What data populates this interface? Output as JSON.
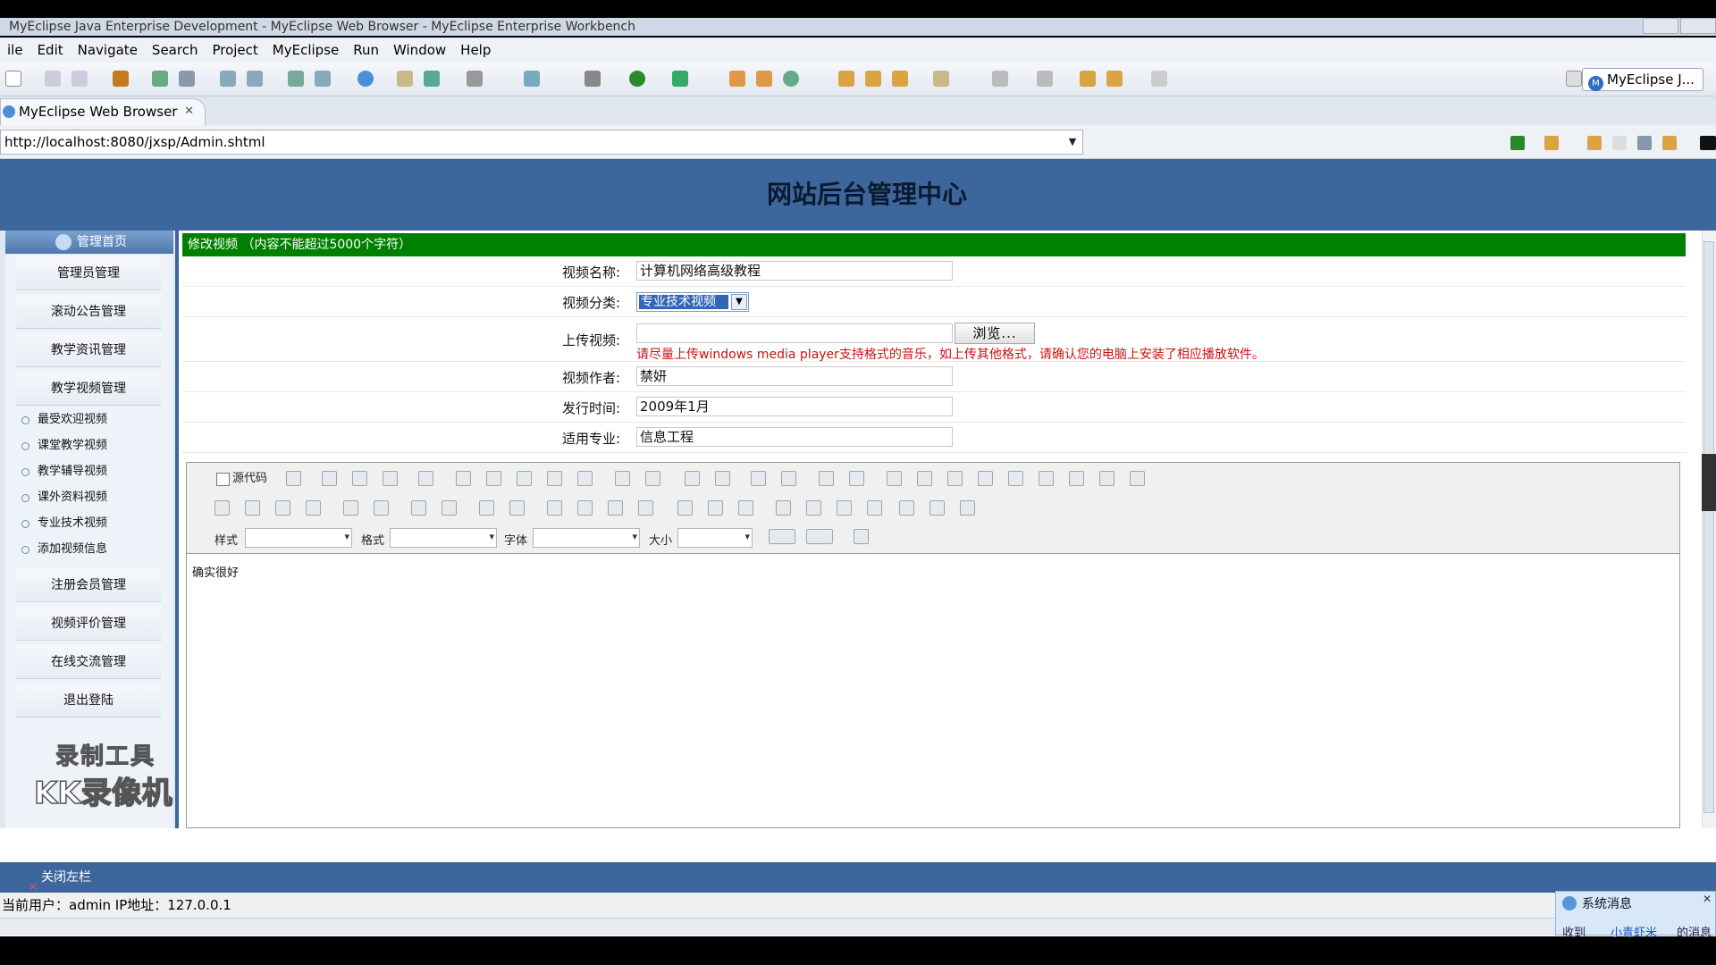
{
  "window": {
    "title": "MyEclipse Java Enterprise Development - MyEclipse Web Browser - MyEclipse Enterprise Workbench"
  },
  "menu": [
    "ile",
    "Edit",
    "Navigate",
    "Search",
    "Project",
    "MyEclipse",
    "Run",
    "Window",
    "Help"
  ],
  "perspective_label": "MyEclipse J...",
  "browser_tab": {
    "label": "MyEclipse Web Browser",
    "close": "✕"
  },
  "address": {
    "url": "http://localhost:8080/jxsp/Admin.shtml"
  },
  "page": {
    "banner_title": "网站后台管理中心",
    "sidebar": {
      "home": "管理首页",
      "items_top": [
        "管理员管理",
        "滚动公告管理",
        "教学资讯管理",
        "教学视频管理"
      ],
      "sub_items": [
        "最受欢迎视频",
        "课堂教学视频",
        "教学辅导视频",
        "课外资料视频",
        "专业技术视频",
        "添加视频信息"
      ],
      "items_bottom": [
        "注册会员管理",
        "视频评价管理",
        "在线交流管理",
        "退出登陆"
      ]
    },
    "watermark": {
      "line1": "录制工具",
      "line2": "KK录像机"
    },
    "form": {
      "header": "修改视频 （内容不能超过5000个字符）",
      "name_label": "视频名称:",
      "name_value": "计算机网络高级教程",
      "category_label": "视频分类:",
      "category_value": "专业技术视频",
      "upload_label": "上传视频:",
      "upload_value": "",
      "browse_label": "浏览...",
      "upload_hint": "请尽量上传windows media player支持格式的音乐，如上传其他格式，请确认您的电脑上安装了相应播放软件。",
      "author_label": "视频作者:",
      "author_value": "禁妍",
      "date_label": "发行时间:",
      "date_value": "2009年1月",
      "major_label": "适用专业:",
      "major_value": "信息工程"
    },
    "editor": {
      "source_label": "源代码",
      "style_label": "样式",
      "format_label": "格式",
      "font_label": "字体",
      "size_label": "大小",
      "content": "确实很好"
    },
    "footer": {
      "close_left": "关闭左栏",
      "status": "当前用户：admin  IP地址：127.0.0.1"
    }
  },
  "popup": {
    "title": "系统消息",
    "line_left": "收到",
    "line_link": "小青虾米",
    "line_right": "的消息"
  },
  "colors": {
    "banner": "#3d679c",
    "form_header": "#008000",
    "hint_text": "#cc1111",
    "selection": "#3165b5"
  }
}
